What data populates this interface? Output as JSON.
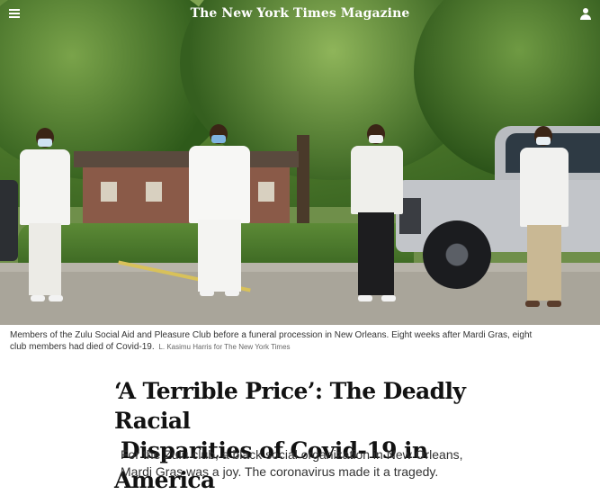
{
  "masthead": {
    "logo": "The New York Times Magazine",
    "menu_icon": "hamburger-menu-icon",
    "user_icon": "user-account-icon"
  },
  "photo": {
    "caption": "Members of the Zulu Social Aid and Pleasure Club before a funeral procession in New Orleans. Eight weeks after Mardi Gras, eight club members had died of Covid-19.",
    "credit": "L. Kasimu Harris for The New York Times"
  },
  "article": {
    "headline_line1": "‘A Terrible Price’: The Deadly Racial",
    "headline_line2": "Disparities of Covid-19 in America",
    "summary_line1": "For the Zulu club, a black social organization in New Orleans,",
    "summary_line2": "Mardi Gras was a joy. The coronavirus made it a tragedy."
  }
}
